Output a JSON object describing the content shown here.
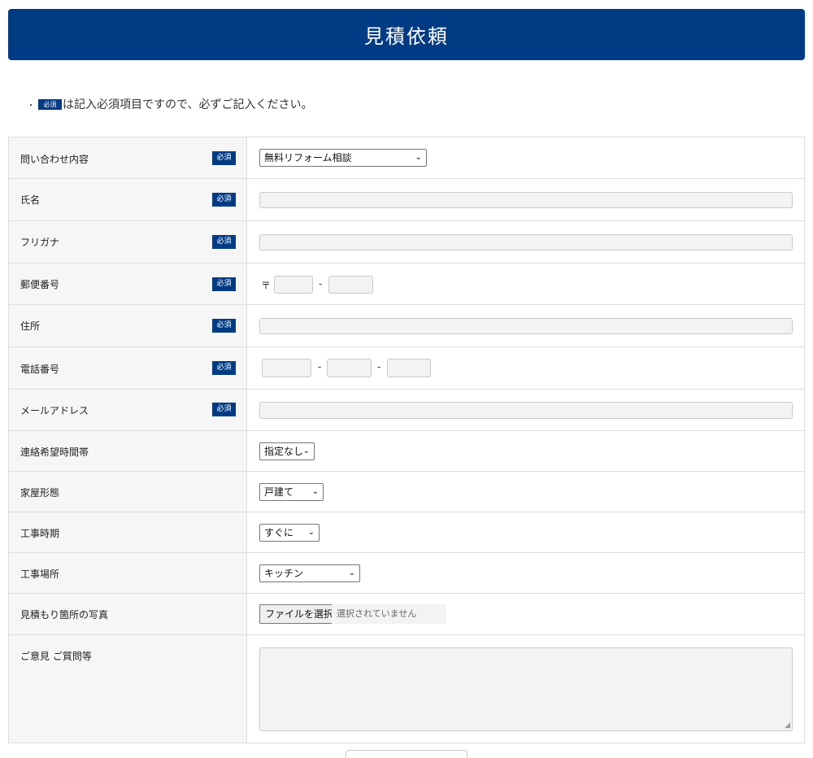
{
  "header": {
    "title": "見積依頼"
  },
  "notice": {
    "bullet": "・",
    "badge": "必須",
    "text": "は記入必須項目ですので、必ずご記入ください。"
  },
  "required_label": "必須",
  "rows": {
    "inquiry": {
      "label": "問い合わせ内容",
      "selected": "無料リフォーム相談"
    },
    "name": {
      "label": "氏名"
    },
    "furigana": {
      "label": "フリガナ"
    },
    "postal": {
      "label": "郵便番号",
      "mark": "〒",
      "sep": "-"
    },
    "address": {
      "label": "住所"
    },
    "phone": {
      "label": "電話番号",
      "sep": "-"
    },
    "email": {
      "label": "メールアドレス"
    },
    "contact_time": {
      "label": "連絡希望時間帯",
      "selected": "指定なし"
    },
    "house_type": {
      "label": "家屋形態",
      "selected": "戸建て"
    },
    "work_timing": {
      "label": "工事時期",
      "selected": "すぐに"
    },
    "work_place": {
      "label": "工事場所",
      "selected": "キッチン"
    },
    "photo": {
      "label": "見積もり箇所の写真",
      "button": "ファイルを選択",
      "status": "選択されていません"
    },
    "comments": {
      "label": "ご意見 ご質問等"
    }
  },
  "colors": {
    "brand": "#003b83",
    "label_bg": "#f6f6f6",
    "border": "#dddddd"
  }
}
